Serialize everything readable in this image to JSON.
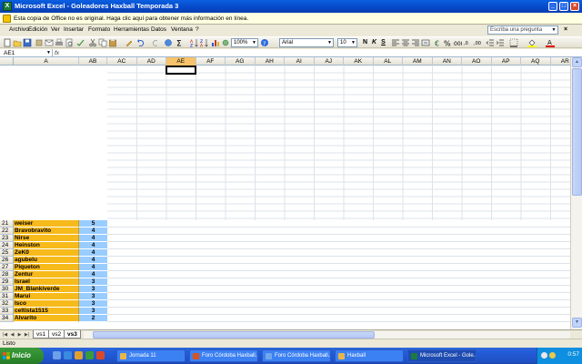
{
  "window": {
    "title": "Microsoft Excel - Goleadores Haxball Temporada 3",
    "buttons": [
      "_",
      "□",
      "×"
    ]
  },
  "infobar": {
    "text": "Esta copia de Office no es original.  Haga clic aquí para obtener más información en línea."
  },
  "menu": {
    "items": [
      "Archivo",
      "Edición",
      "Ver",
      "Insertar",
      "Formato",
      "Herramientas",
      "Datos",
      "Ventana",
      "?"
    ],
    "help_placeholder": "Escriba una pregunta"
  },
  "toolbar": {
    "zoom": "100%",
    "font": "Arial",
    "size": "10"
  },
  "formula_bar": {
    "name_box": "AE1",
    "fx": "fx",
    "value": ""
  },
  "grid": {
    "frozen_cols": [
      "A",
      "AB"
    ],
    "scroll_cols": [
      "AC",
      "AD",
      "AE",
      "AF",
      "AG",
      "AH",
      "AI",
      "AJ",
      "AK",
      "AL",
      "AM",
      "AN",
      "AO",
      "AP",
      "AQ",
      "AR"
    ],
    "active_col": "AE",
    "rows": [
      {
        "num": "21",
        "name": "weiser",
        "score": "5"
      },
      {
        "num": "22",
        "name": "Bravobravito",
        "score": "4"
      },
      {
        "num": "23",
        "name": "Nirse",
        "score": "4"
      },
      {
        "num": "24",
        "name": "Heinston",
        "score": "4"
      },
      {
        "num": "25",
        "name": "ZeK0",
        "score": "4"
      },
      {
        "num": "26",
        "name": "agubelu",
        "score": "4"
      },
      {
        "num": "27",
        "name": "Piqueton",
        "score": "4"
      },
      {
        "num": "28",
        "name": "Zentur",
        "score": "4"
      },
      {
        "num": "29",
        "name": "Israel",
        "score": "3"
      },
      {
        "num": "30",
        "name": "JM_Blankiverde",
        "score": "3"
      },
      {
        "num": "31",
        "name": "Marui",
        "score": "3"
      },
      {
        "num": "32",
        "name": "Isco",
        "score": "3"
      },
      {
        "num": "33",
        "name": "celtista1515",
        "score": "3"
      },
      {
        "num": "34",
        "name": "Alvarito",
        "score": "2"
      }
    ]
  },
  "sheets": {
    "tabs": [
      "vs1",
      "vs2",
      "vs3"
    ],
    "active": "vs3"
  },
  "status": {
    "text": "Listo"
  },
  "taskbar": {
    "start": "Inicio",
    "buttons": [
      {
        "label": "Jornada 11",
        "color": "#E8B64A"
      },
      {
        "label": "Foro Córdoba Haxball...",
        "color": "#D9531E"
      },
      {
        "label": "Foro Córdoba Haxball...",
        "color": "#6FA8E8"
      },
      {
        "label": "Haxball",
        "color": "#E8B64A"
      },
      {
        "label": "Microsoft Excel - Gole...",
        "color": "#1D7A3A"
      }
    ],
    "clock": "0:57"
  },
  "colors": {
    "name_fill": "#F7BA1B",
    "score_fill": "#99CCFF",
    "active_header": "#F6C36B",
    "titlebar": "#0A5FE0"
  }
}
